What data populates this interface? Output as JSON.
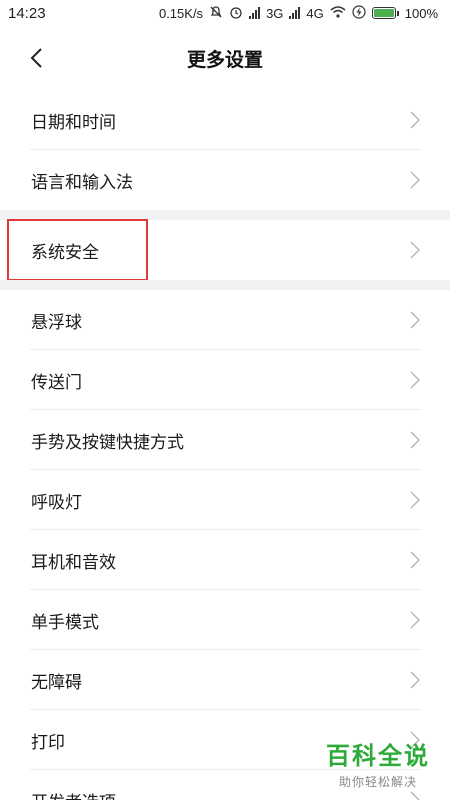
{
  "status_bar": {
    "time": "14:23",
    "net_speed": "0.15K/s",
    "network_3g": "3G",
    "network_4g": "4G",
    "battery": "100%"
  },
  "header": {
    "title": "更多设置"
  },
  "group1": [
    {
      "label": "日期和时间"
    },
    {
      "label": "语言和输入法"
    }
  ],
  "group2": [
    {
      "label": "系统安全"
    }
  ],
  "group3": [
    {
      "label": "悬浮球"
    },
    {
      "label": "传送门"
    },
    {
      "label": "手势及按键快捷方式"
    },
    {
      "label": "呼吸灯"
    },
    {
      "label": "耳机和音效"
    },
    {
      "label": "单手模式"
    },
    {
      "label": "无障碍"
    },
    {
      "label": "打印"
    },
    {
      "label": "开发者选项"
    }
  ],
  "watermark": {
    "title": "百科全说",
    "subtitle": "助你轻松解决"
  }
}
